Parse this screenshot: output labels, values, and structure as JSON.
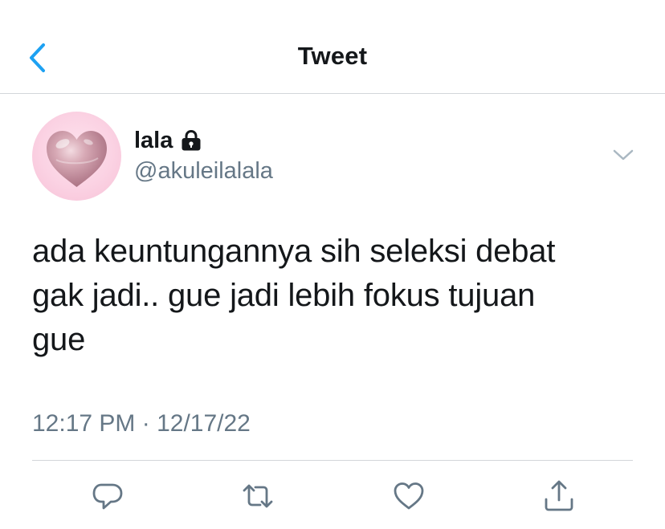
{
  "header": {
    "back_icon": "chevron-left-icon",
    "title": "Tweet"
  },
  "author": {
    "avatar_icon": "pink-heart-avatar",
    "display_name": "lala",
    "protected_icon": "lock-icon",
    "handle": "@akuleilalala",
    "menu_icon": "chevron-down-icon"
  },
  "tweet": {
    "lines": [
      "ada keuntungannya sih seleksi debat",
      "gak jadi.. gue jadi lebih fokus tujuan",
      "gue"
    ],
    "timestamp": "12:17 PM · 12/17/22"
  },
  "actions": [
    {
      "name": "reply",
      "icon": "comment-icon"
    },
    {
      "name": "retweet",
      "icon": "retweet-icon"
    },
    {
      "name": "like",
      "icon": "heart-icon"
    },
    {
      "name": "share",
      "icon": "share-icon"
    }
  ],
  "colors": {
    "accent": "#1da1f2",
    "text_primary": "#14171a",
    "text_secondary": "#657786",
    "divider": "#d3d6da",
    "icon_gray": "#657786"
  }
}
